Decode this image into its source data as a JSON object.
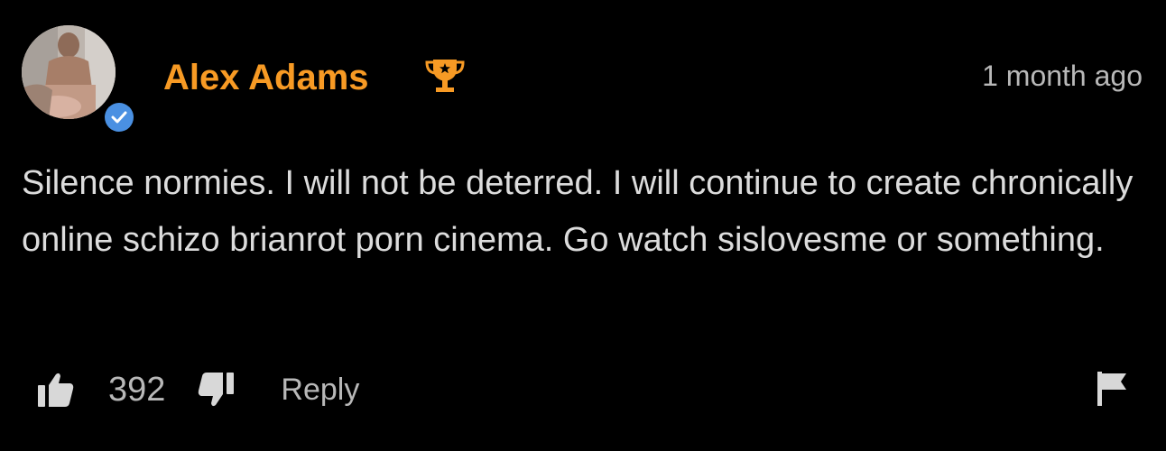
{
  "comment": {
    "username": "Alex Adams",
    "timestamp": "1 month ago",
    "body": "Silence normies. I will not be deterred. I will continue to create chronically online schizo brianrot porn cinema. Go watch sislovesme or something.",
    "like_count": "392",
    "reply_label": "Reply"
  },
  "icons": {
    "trophy": "trophy-icon",
    "verified": "verified-check-icon",
    "like": "thumbs-up-icon",
    "dislike": "thumbs-down-icon",
    "flag": "flag-icon"
  },
  "colors": {
    "background": "#000000",
    "username": "#f79a24",
    "verified": "#4a90e2",
    "text": "#dcdcdc",
    "muted": "#b8b8b8"
  }
}
